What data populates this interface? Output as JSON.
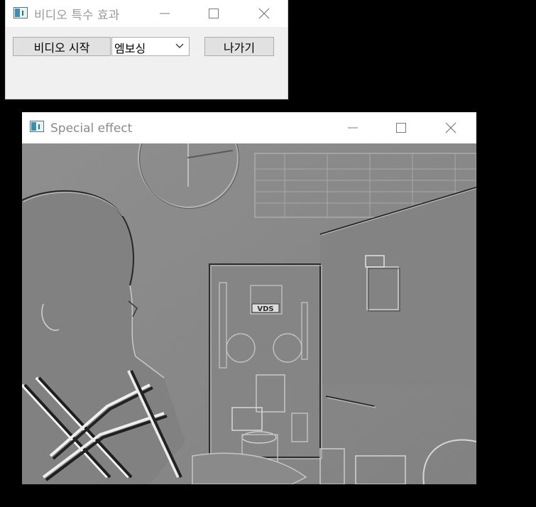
{
  "control_window": {
    "title": "비디오 특수 효과",
    "start_button_label": "비디오 시작",
    "effect_select": {
      "selected": "엠보싱"
    },
    "exit_button_label": "나가기"
  },
  "effect_window": {
    "title": "Special effect",
    "video_frame_label": "VDS"
  },
  "colors": {
    "desktop": "#000000",
    "dialog_bg": "#f0f0f0",
    "titlebar_bg": "#ffffff",
    "button_bg": "#e1e1e1",
    "button_border": "#adadad",
    "emboss_base": "#808080"
  },
  "icons": {
    "app": "window-app-icon",
    "minimize": "minimize-icon",
    "maximize": "maximize-icon",
    "close": "close-icon",
    "dropdown": "chevron-down-icon"
  }
}
